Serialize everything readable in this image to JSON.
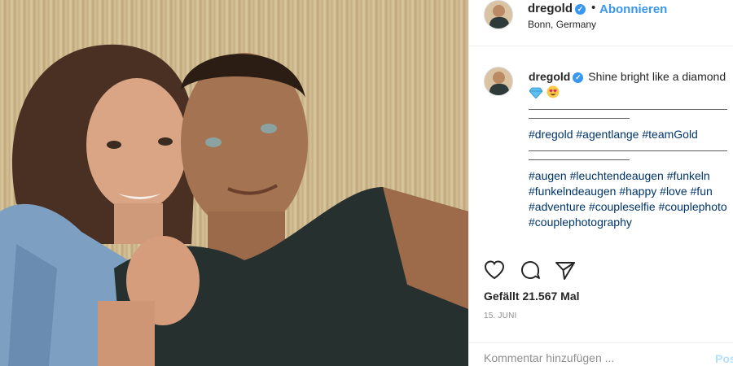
{
  "header": {
    "username": "dregold",
    "separator": "•",
    "follow_label": "Abonnieren",
    "location": "Bonn, Germany"
  },
  "caption": {
    "username": "dregold",
    "text": "Shine bright like a diamond",
    "emojis": [
      "gem-emoji",
      "heart-eyes-emoji"
    ],
    "hashtags_line1": [
      "#dregold",
      "#agentlange",
      "#teamGold"
    ],
    "hashtags_line2": [
      "#augen",
      "#leuchtendeaugen",
      "#funkeln",
      "#funkelndeaugen",
      "#happy",
      "#love",
      "#fun",
      "#adventure",
      "#coupleselfie",
      "#couplephoto",
      "#couplephotography"
    ]
  },
  "actions": {
    "icons": [
      "heart-icon",
      "comment-icon",
      "share-icon"
    ]
  },
  "likes_text": "Gefällt 21.567 Mal",
  "date_text": "15. JUNI",
  "comment_box": {
    "placeholder": "Kommentar hinzufügen ...",
    "post_label": "Posten"
  },
  "colors": {
    "accent": "#3897f0",
    "hashtag": "#003569",
    "muted": "#8e8e8e",
    "post_disabled": "#b2dffc"
  }
}
